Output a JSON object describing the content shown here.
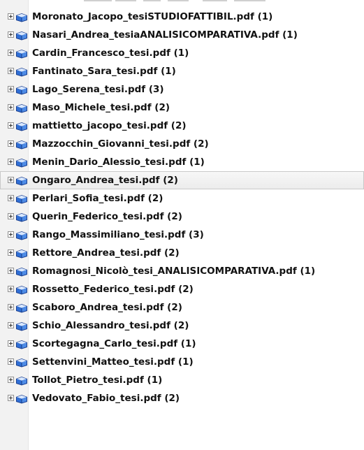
{
  "files": [
    {
      "label": "Moronato_Jacopo_tesiSTUDIOFATTIBIL.pdf (1)"
    },
    {
      "label": "Nasari_Andrea_tesiaANALISICOMPARATIVA.pdf (1)"
    },
    {
      "label": "Cardin_Francesco_tesi.pdf (1)"
    },
    {
      "label": "Fantinato_Sara_tesi.pdf (1)"
    },
    {
      "label": "Lago_Serena_tesi.pdf (3)"
    },
    {
      "label": "Maso_Michele_tesi.pdf (2)"
    },
    {
      "label": "mattietto_jacopo_tesi.pdf (2)"
    },
    {
      "label": "Mazzocchin_Giovanni_tesi.pdf (2)"
    },
    {
      "label": "Menin_Dario_Alessio_tesi.pdf (1)"
    },
    {
      "label": "Ongaro_Andrea_tesi.pdf (2)",
      "selected": true
    },
    {
      "label": "Perlari_Sofia_tesi.pdf (2)"
    },
    {
      "label": "Querin_Federico_tesi.pdf (2)"
    },
    {
      "label": "Rango_Massimiliano_tesi.pdf (3)"
    },
    {
      "label": "Rettore_Andrea_tesi.pdf (2)"
    },
    {
      "label": "Romagnosi_Nicolò_tesi_ANALISICOMPARATIVA.pdf (1)"
    },
    {
      "label": "Rossetto_Federico_tesi.pdf (2)"
    },
    {
      "label": "Scaboro_Andrea_tesi.pdf (2)"
    },
    {
      "label": "Schio_Alessandro_tesi.pdf (2)"
    },
    {
      "label": "Scortegagna_Carlo_tesi.pdf (1)"
    },
    {
      "label": "Settenvini_Matteo_tesi.pdf (1)"
    },
    {
      "label": "Tollot_Pietro_tesi.pdf (1)"
    },
    {
      "label": "Vedovato_Fabio_tesi.pdf (2)"
    }
  ],
  "icons": {
    "expander": "plus-box-icon",
    "item": "book-icon"
  },
  "colors": {
    "book_blue": "#2f6fd6",
    "book_dark": "#1b3f8f",
    "selection_border": "#c9c9c9",
    "gutter": "#f2f2f2"
  }
}
